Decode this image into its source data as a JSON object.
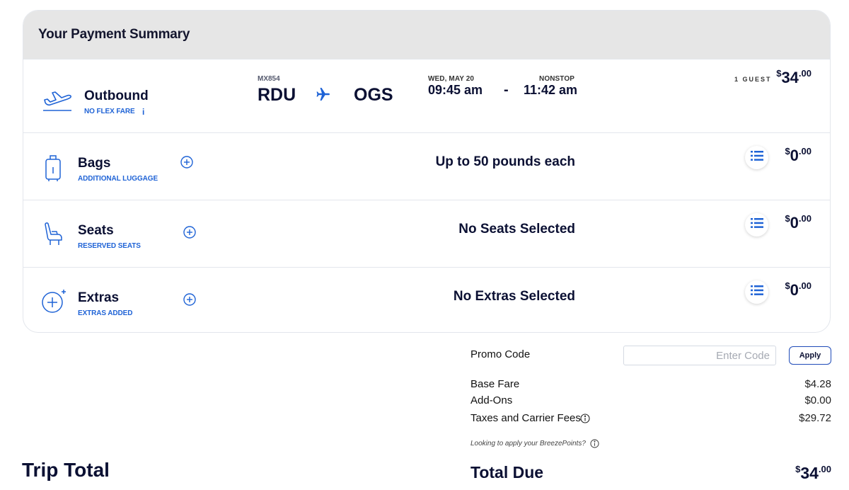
{
  "summary": {
    "title": "Your Payment Summary"
  },
  "outbound": {
    "title": "Outbound",
    "fare_type": "NO FLEX FARE",
    "info_label": "i",
    "flight_number": "MX854",
    "origin": "RDU",
    "destination": "OGS",
    "date": "WED, MAY 20",
    "depart_time": "09:45 am",
    "separator": "-",
    "stops": "NONSTOP",
    "arrive_time": "11:42 am",
    "guests": "1 GUEST",
    "price": {
      "currency": "$",
      "whole": "34",
      "cents": ".00"
    }
  },
  "addons": [
    {
      "title": "Bags",
      "subtitle": "ADDITIONAL LUGGAGE",
      "summary": "Up to 50 pounds each",
      "icon": "luggage-icon",
      "price": {
        "currency": "$",
        "whole": "0",
        "cents": ".00"
      }
    },
    {
      "title": "Seats",
      "subtitle": "RESERVED SEATS",
      "summary": "No Seats Selected",
      "icon": "seat-icon",
      "price": {
        "currency": "$",
        "whole": "0",
        "cents": ".00"
      }
    },
    {
      "title": "Extras",
      "subtitle": "EXTRAS ADDED",
      "summary": "No Extras Selected",
      "icon": "extras-plus-icon",
      "price": {
        "currency": "$",
        "whole": "0",
        "cents": ".00"
      }
    }
  ],
  "promo": {
    "label": "Promo Code",
    "placeholder": "Enter Code",
    "value": "",
    "apply_label": "Apply"
  },
  "breakdown": [
    {
      "label": "Base Fare",
      "amount": "$4.28"
    },
    {
      "label": "Add-Ons",
      "amount": "$0.00"
    },
    {
      "label": "Taxes and Carrier Fees",
      "amount": "$29.72"
    }
  ],
  "breezepoints_note": "Looking to apply your BreezePoints?",
  "trip_total_label": "Trip Total",
  "total_due": {
    "label": "Total Due",
    "currency": "$",
    "whole": "34",
    "cents": ".00"
  },
  "colors": {
    "accent_blue": "#1f63d6",
    "navy_text": "#0b1033",
    "header_gray": "#e6e6e6"
  }
}
